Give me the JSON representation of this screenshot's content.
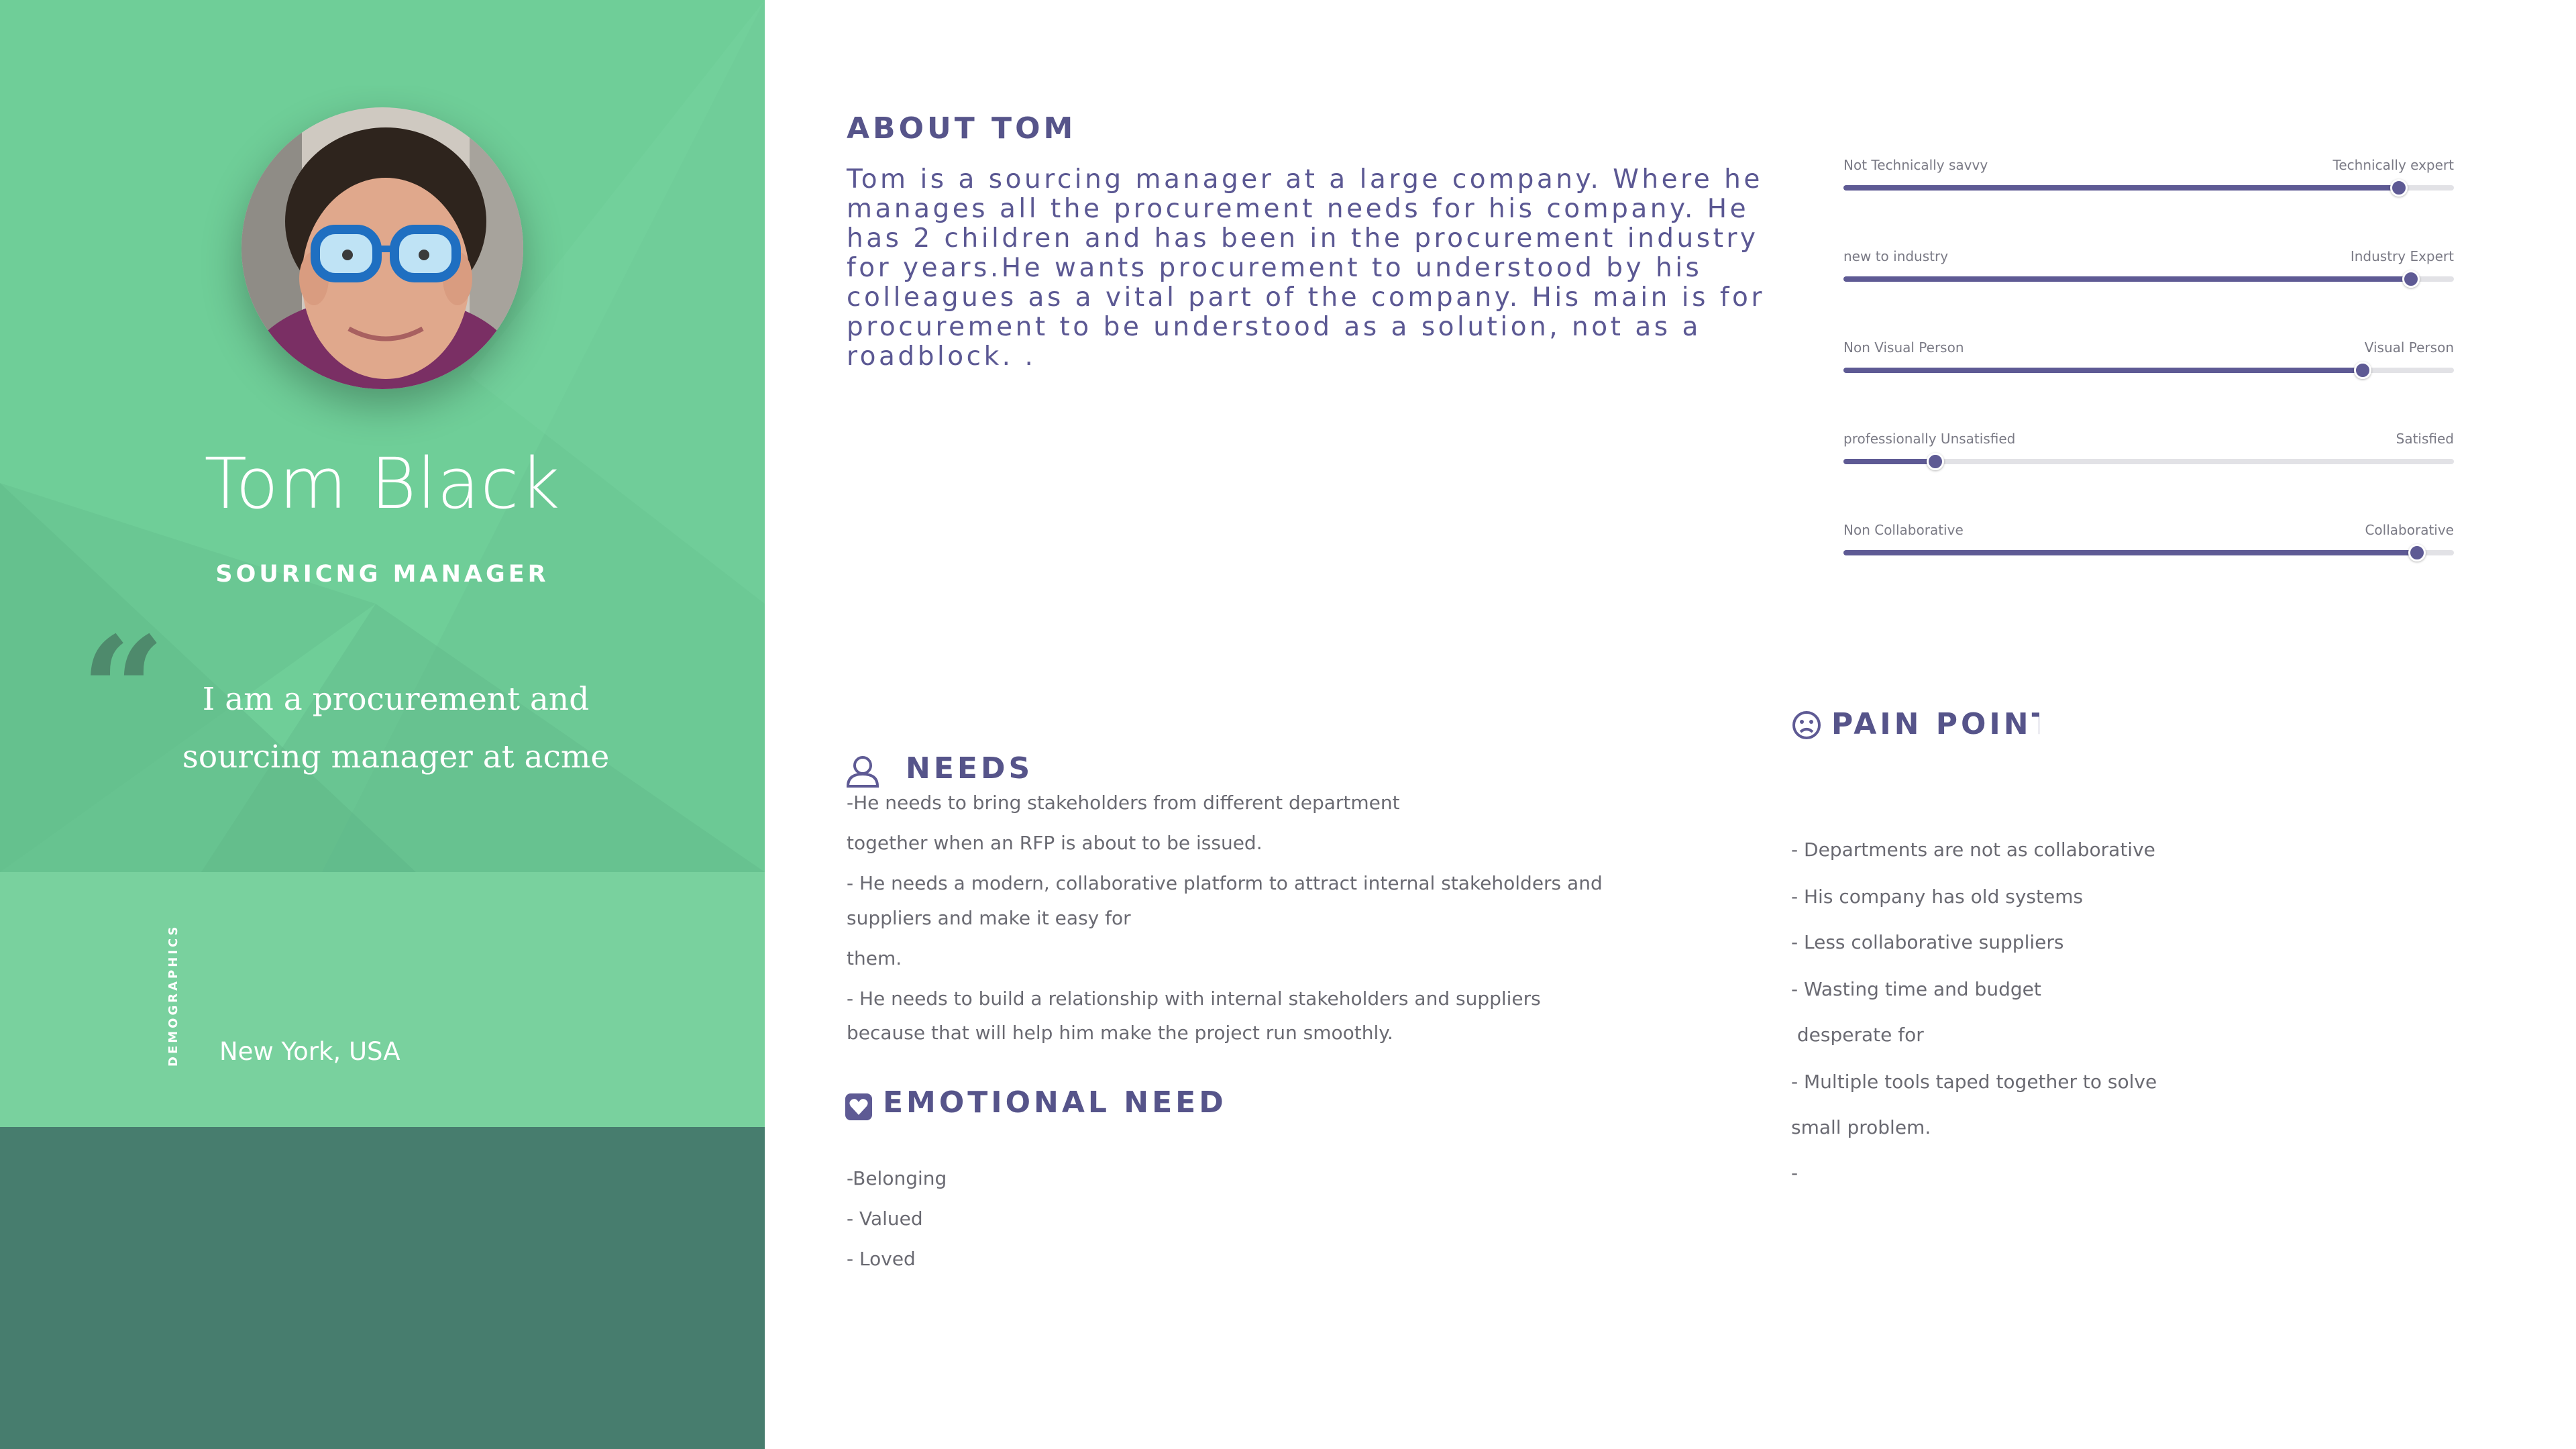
{
  "persona": {
    "name": "Tom Black",
    "role": "SOURICNG MANAGER",
    "quote_mark": "“",
    "quote": "I am a procurement and sourcing manager at acme",
    "demographics_label": "DEMOGRAPHICS",
    "location": "New York, USA"
  },
  "about": {
    "title": "ABOUT TOM",
    "text": "Tom is a sourcing manager at a large company. Where he manages all the procurement needs for his company. He has 2 children and has been in the procurement industry for years.He wants procurement to understood by his colleagues as a vital part of the company. His main is for procurement to be understood as a solution, not as a roadblock. ."
  },
  "sliders": [
    {
      "left_label": "Not Technically savvy",
      "right_label": "Technically expert",
      "value": 0.91
    },
    {
      "left_label": "new to industry",
      "right_label": "Industry Expert",
      "value": 0.93
    },
    {
      "left_label": "Non Visual Person",
      "right_label": "Visual Person",
      "value": 0.85
    },
    {
      "left_label": "professionally Unsatisfied",
      "right_label": "Satisfied",
      "value": 0.15
    },
    {
      "left_label": "Non Collaborative",
      "right_label": "Collaborative",
      "value": 0.94
    }
  ],
  "needs": {
    "title": "NEEDS",
    "icon": "user-icon",
    "items": [
      "-He needs to bring stakeholders from different department",
      "together when an RFP is about to be issued.",
      "- He needs a modern, collaborative platform to attract internal stakeholders and",
      "suppliers and make it easy for",
      "them.",
      "- He needs to build a relationship with internal stakeholders and suppliers",
      "because that will help him make the project run smoothly."
    ]
  },
  "emotional_need": {
    "title": "EMOTIONAL NEED",
    "icon": "heart-icon",
    "items": [
      "-Belonging",
      "- Valued",
      "- Loved"
    ]
  },
  "pain_points": {
    "title": "PAIN POINTS",
    "icon": "sad-face-icon",
    "items": [
      "- Departments are not as collaborative",
      "- His company has old systems",
      "- Less collaborative suppliers",
      "- Wasting time and budget",
      " desperate for",
      "- Multiple tools taped together to solve",
      "small problem.",
      "-"
    ]
  },
  "colors": {
    "green": "#6fce98",
    "light_green": "#79d19e",
    "dark_green": "#477d6e",
    "purple": "#5e5a94"
  }
}
